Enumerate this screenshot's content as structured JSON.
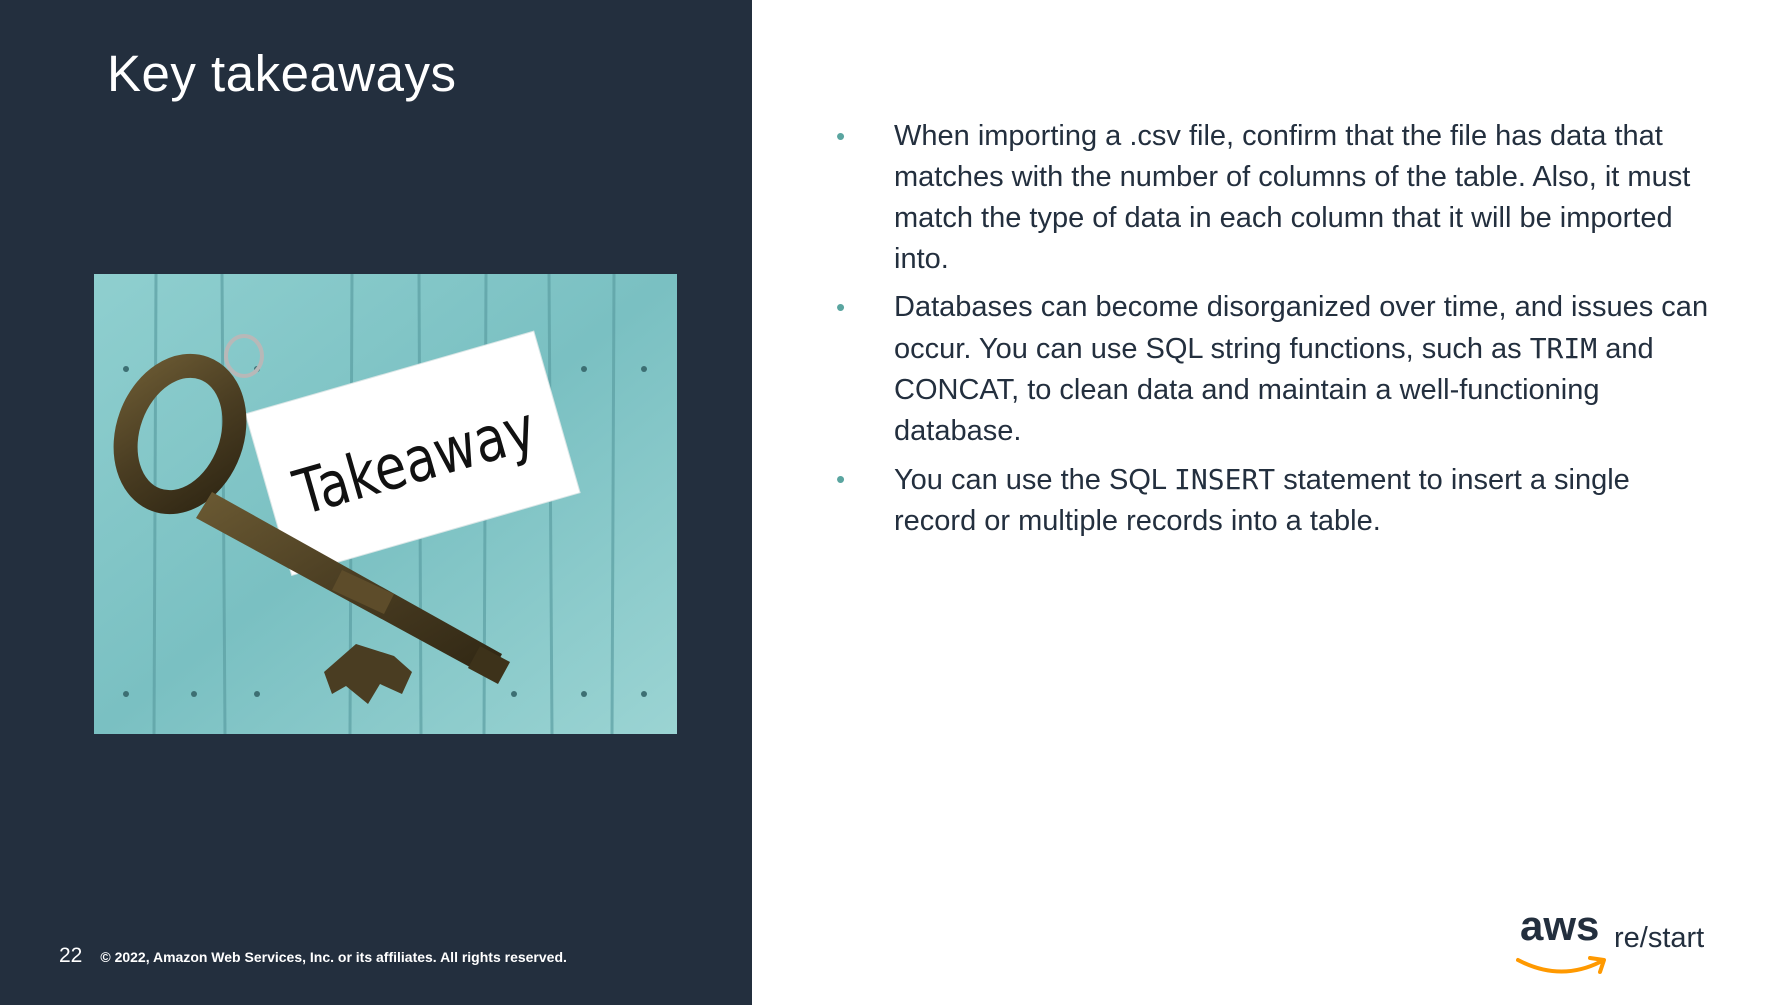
{
  "slide": {
    "title": "Key takeaways",
    "page_number": "22",
    "copyright": "© 2022, Amazon Web Services, Inc. or its affiliates. All rights reserved."
  },
  "image": {
    "tag_text": "Takeaway"
  },
  "bullets": [
    {
      "text": "When importing a .csv file, confirm that the file has data that matches with the number of columns of the table. Also, it must match the type of data in each column that it will be imported into."
    },
    {
      "text_before": "Databases can become disorganized over time, and issues can occur. You can use SQL string functions, such as ",
      "code1": "TRIM",
      "text_between": " and CONCAT, to clean data and maintain a well-functioning database.",
      "code2": ""
    },
    {
      "text_before": "You can use the SQL ",
      "code1": "INSERT",
      "text_after": " statement to insert a single record or multiple records into a table."
    }
  ],
  "logo": {
    "brand": "aws",
    "product": "re/start"
  },
  "colors": {
    "panel": "#232f3e",
    "bullet": "#5aa5a0",
    "smile": "#ff9900"
  }
}
